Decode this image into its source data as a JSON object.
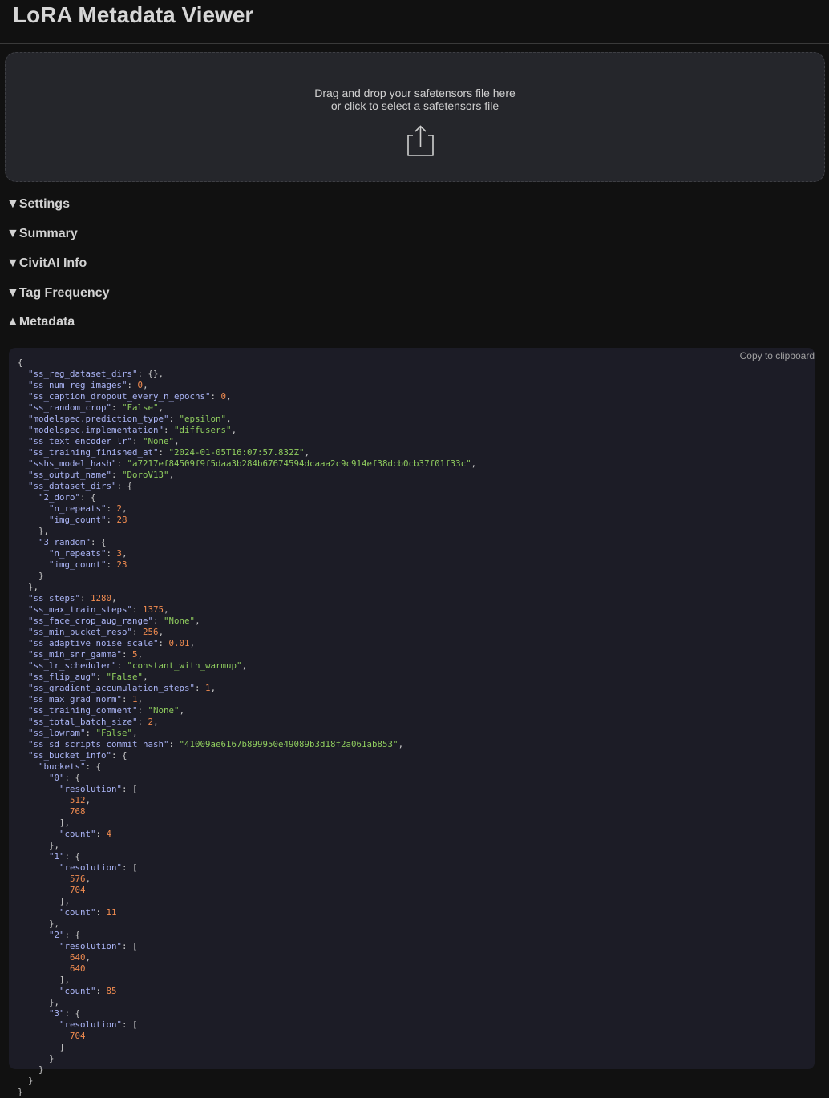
{
  "header": {
    "title": "LoRA Metadata Viewer"
  },
  "dropzone": {
    "line1": "Drag and drop your safetensors file here",
    "line2": "or click to select a safetensors file",
    "icon": "upload-icon"
  },
  "sections": [
    {
      "label": "Settings",
      "arrow": "▼"
    },
    {
      "label": "Summary",
      "arrow": "▼"
    },
    {
      "label": "CivitAI Info",
      "arrow": "▼"
    },
    {
      "label": "Tag Frequency",
      "arrow": "▼"
    },
    {
      "label": "Metadata",
      "arrow": "▲"
    }
  ],
  "metadata_panel": {
    "copy_label": "Copy to clipboard"
  },
  "metadata": {
    "ss_reg_dataset_dirs": {},
    "ss_num_reg_images": 0,
    "ss_caption_dropout_every_n_epochs": 0,
    "ss_random_crop": "False",
    "modelspec.prediction_type": "epsilon",
    "modelspec.implementation": "diffusers",
    "ss_text_encoder_lr": "None",
    "ss_training_finished_at": "2024-01-05T16:07:57.832Z",
    "sshs_model_hash": "a7217ef84509f9f5daa3b284b67674594dcaaa2c9c914ef38dcb0cb37f01f33c",
    "ss_output_name": "DoroV13",
    "ss_dataset_dirs": {
      "2_doro": {
        "n_repeats": 2,
        "img_count": 28
      },
      "3_random": {
        "n_repeats": 3,
        "img_count": 23
      }
    },
    "ss_steps": 1280,
    "ss_max_train_steps": 1375,
    "ss_face_crop_aug_range": "None",
    "ss_min_bucket_reso": 256,
    "ss_adaptive_noise_scale": 0.01,
    "ss_min_snr_gamma": 5,
    "ss_lr_scheduler": "constant_with_warmup",
    "ss_flip_aug": "False",
    "ss_gradient_accumulation_steps": 1,
    "ss_max_grad_norm": 1,
    "ss_training_comment": "None",
    "ss_total_batch_size": 2,
    "ss_lowram": "False",
    "ss_sd_scripts_commit_hash": "41009ae6167b899950e49089b3d18f2a061ab853",
    "ss_bucket_info": {
      "buckets": {
        "0": {
          "resolution": [
            512,
            768
          ],
          "count": 4
        },
        "1": {
          "resolution": [
            576,
            704
          ],
          "count": 11
        },
        "2": {
          "resolution": [
            640,
            640
          ],
          "count": 85
        },
        "3": {
          "resolution": [
            704
          ]
        }
      }
    }
  }
}
